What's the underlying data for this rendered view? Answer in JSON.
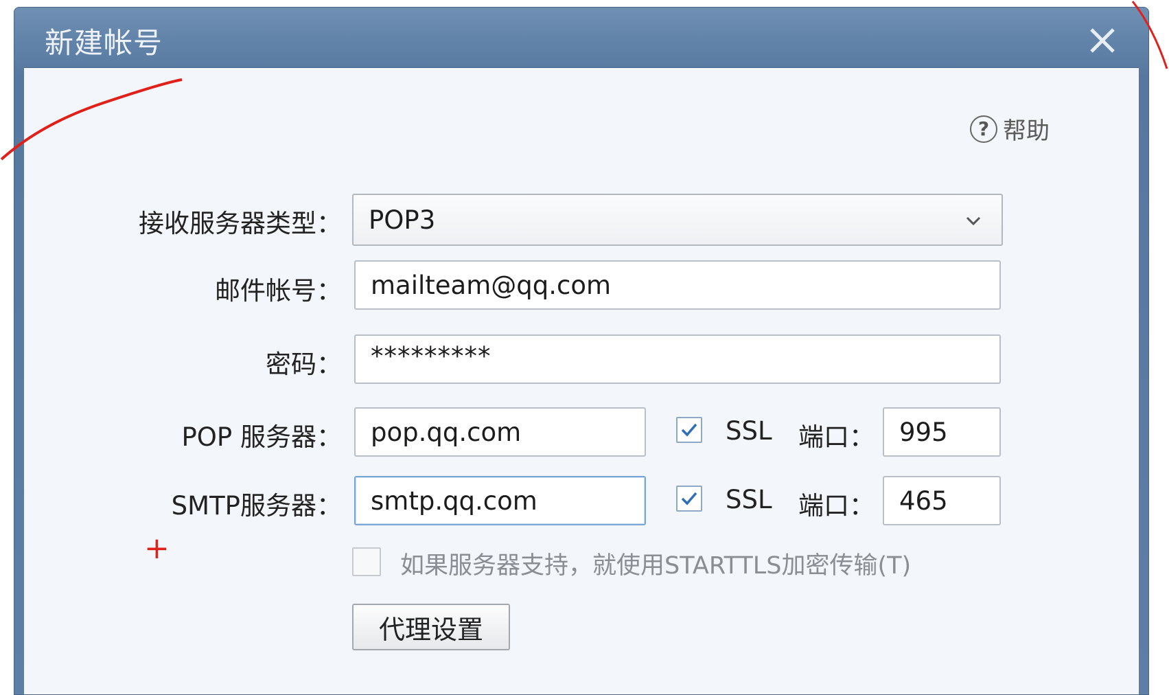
{
  "window": {
    "title": "新建帐号",
    "close_icon": "close-icon"
  },
  "help": {
    "icon": "question-circle-icon",
    "label": "帮助"
  },
  "form": {
    "server_type": {
      "label": "接收服务器类型：",
      "value": "POP3",
      "icon": "chevron-down-icon"
    },
    "email": {
      "label": "邮件帐号：",
      "value": "mailteam@qq.com"
    },
    "password": {
      "label": "密码：",
      "value": "*********"
    },
    "pop": {
      "label": "POP 服务器：",
      "value": "pop.qq.com",
      "ssl_checked": true,
      "ssl_label": "SSL",
      "port_label": "端口：",
      "port": "995"
    },
    "smtp": {
      "label": "SMTP服务器：",
      "value": "smtp.qq.com",
      "ssl_checked": true,
      "ssl_label": "SSL",
      "port_label": "端口：",
      "port": "465"
    },
    "starttls": {
      "checked": false,
      "label": "如果服务器支持，就使用STARTTLS加密传输(T)"
    },
    "proxy_button": "代理设置"
  },
  "colors": {
    "annotation": "#e0211b",
    "titlebar": "#5d7ea5",
    "checkbox_check": "#2f6fb6"
  },
  "annotations": {
    "plus_glyph": "+"
  }
}
